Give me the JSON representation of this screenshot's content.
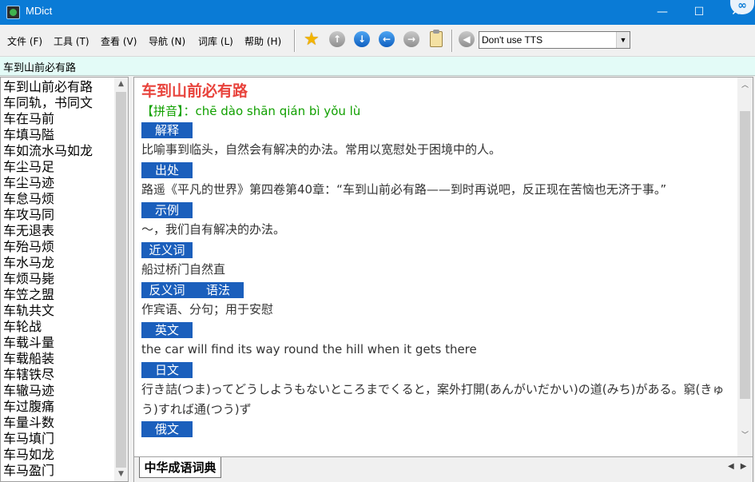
{
  "window": {
    "title": "MDict",
    "minimize": "—",
    "maximize": "☐",
    "close": "✕",
    "badge": "∞"
  },
  "menu": [
    {
      "label": "文件 (F)"
    },
    {
      "label": "工具 (T)"
    },
    {
      "label": "查看 (V)"
    },
    {
      "label": "导航 (N)"
    },
    {
      "label": "词库 (L)"
    },
    {
      "label": "帮助 (H)"
    }
  ],
  "toolbar": {
    "icons": [
      "star-icon",
      "up-arrow-icon",
      "down-arrow-icon",
      "back-arrow-icon",
      "forward-arrow-icon",
      "clipboard-icon",
      "speaker-icon"
    ],
    "tts_selected": "Don't use TTS"
  },
  "search": {
    "value": "车到山前必有路"
  },
  "word_list": [
    "车到山前必有路",
    "车同轨，书同文",
    "车在马前",
    "车填马隘",
    "车如流水马如龙",
    "车尘马足",
    "车尘马迹",
    "车怠马烦",
    "车攻马同",
    "车无退表",
    "车殆马烦",
    "车水马龙",
    "车烦马毙",
    "车笠之盟",
    "车轨共文",
    "车轮战",
    "车载斗量",
    "车载船装",
    "车辖铁尽",
    "车辙马迹",
    "车过腹痛",
    "车量斗数",
    "车马填门",
    "车马如龙",
    "车马盈门"
  ],
  "entry": {
    "headword": "车到山前必有路",
    "pinyin": "【拼音】：chē dào shān qián bì yǒu lù",
    "sections": [
      {
        "label": "解释",
        "text": "比喻事到临头，自然会有解决的办法。常用以宽慰处于困境中的人。"
      },
      {
        "label": "出处",
        "text": "路遥《平凡的世界》第四卷第40章：“车到山前必有路——到时再说吧，反正现在苦恼也无济于事。”"
      },
      {
        "label": "示例",
        "text": "～，我们自有解决的办法。"
      },
      {
        "label": "近义词",
        "text": "船过桥门自然直"
      },
      {
        "label": "反义词",
        "text": ""
      },
      {
        "label": "语法",
        "text": "作宾语、分句；用于安慰"
      },
      {
        "label": "英文",
        "text": "the car will find its way round the hill when it gets there"
      },
      {
        "label": "日文",
        "text": "行き詰(つま)ってどうしようもないところまでくると，案外打開(あんがいだかい)の道(みち)がある。窮(きゅう)すれば通(つう)ず"
      },
      {
        "label": "俄文",
        "text": ""
      }
    ]
  },
  "dictionary_tab": "中华成语词典",
  "colors": {
    "titlebar": "#0a7bd6",
    "headword": "#e8433c",
    "pinyin": "#11a000",
    "section_label_bg": "#1b5fbc",
    "search_bg": "#e3fbf7"
  }
}
